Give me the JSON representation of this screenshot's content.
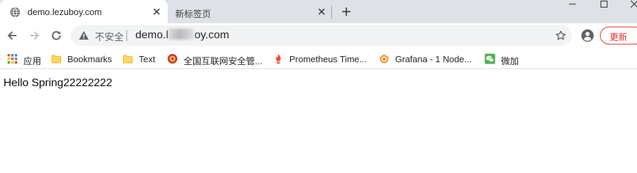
{
  "tabs": [
    {
      "title": "demo.lezuboy.com",
      "favicon": "globe-icon",
      "active": true
    },
    {
      "title": "新标签页",
      "active": false
    }
  ],
  "toolbar": {
    "security_label": "不安全",
    "url_start": "demo.l",
    "url_end": "oy.com",
    "update_label": "更新"
  },
  "bookmarks": {
    "apps_label": "应用",
    "items": [
      {
        "label": "Bookmarks",
        "icon": "folder-icon"
      },
      {
        "label": "Text",
        "icon": "folder-icon"
      },
      {
        "label": "全国互联网安全管...",
        "icon": "police-badge-icon"
      },
      {
        "label": "Prometheus Time...",
        "icon": "prometheus-icon"
      },
      {
        "label": "Grafana - 1 Node...",
        "icon": "grafana-icon"
      },
      {
        "label": "微加",
        "icon": "wechat-icon"
      }
    ]
  },
  "page": {
    "body_text": "Hello Spring22222222"
  },
  "colors": {
    "tabstrip": "#dee1e6",
    "omnibox": "#f1f3f4",
    "update_red": "#d93025",
    "folder_yellow": "#fdd663"
  }
}
